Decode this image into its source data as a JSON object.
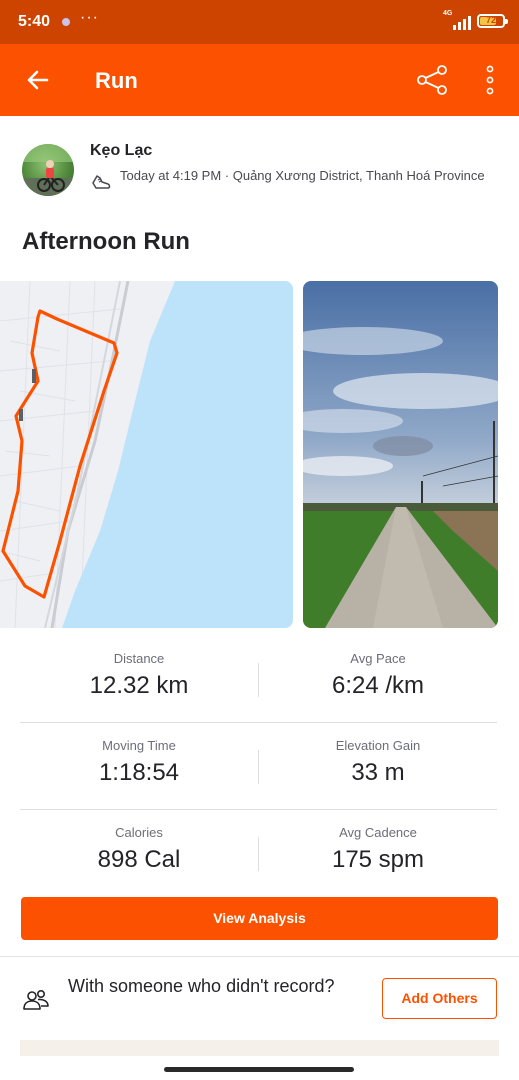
{
  "status_bar": {
    "time": "5:40",
    "more": "···",
    "network": "4G",
    "battery_level": 72,
    "battery_text": "72"
  },
  "app_bar": {
    "title": "Run",
    "back_icon": "arrow-left-icon",
    "share_icon": "share-icon",
    "more_icon": "more-vertical-icon"
  },
  "athlete": {
    "name": "Kẹo Lạc",
    "meta": "Today at 4:19 PM · Quảng Xương District, Thanh Hoá Province",
    "sport_icon": "run-shoe-icon"
  },
  "activity": {
    "title": "Afternoon Run"
  },
  "stats": [
    {
      "label": "Distance",
      "value": "12.32 km"
    },
    {
      "label": "Avg Pace",
      "value": "6:24 /km"
    },
    {
      "label": "Moving Time",
      "value": "1:18:54"
    },
    {
      "label": "Elevation Gain",
      "value": "33 m"
    },
    {
      "label": "Calories",
      "value": "898 Cal"
    },
    {
      "label": "Avg Cadence",
      "value": "175 spm"
    }
  ],
  "actions": {
    "view_analysis": "View Analysis",
    "with_others_text": "With someone who didn't record?",
    "add_others": "Add Others"
  },
  "colors": {
    "brand": "#fc5200",
    "status_bar": "#cc4400",
    "route": "#fc5200",
    "water": "#bde3fa"
  }
}
